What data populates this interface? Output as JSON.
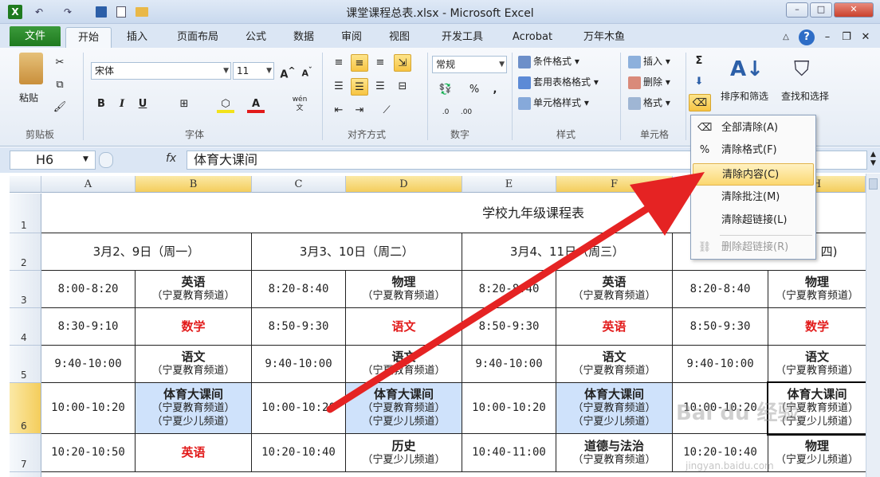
{
  "window": {
    "title": "课堂课程总表.xlsx - Microsoft Excel",
    "controls": [
      "–",
      "□",
      "✕"
    ]
  },
  "tabs": [
    {
      "label": "文件"
    },
    {
      "label": "开始"
    },
    {
      "label": "插入"
    },
    {
      "label": "页面布局"
    },
    {
      "label": "公式"
    },
    {
      "label": "数据"
    },
    {
      "label": "审阅"
    },
    {
      "label": "视图"
    },
    {
      "label": "开发工具"
    },
    {
      "label": "Acrobat"
    },
    {
      "label": "万年木鱼"
    }
  ],
  "ribbon": {
    "paste": "粘贴",
    "font_name": "宋体",
    "font_size": "11",
    "number_format": "常规",
    "conditional": "条件格式",
    "table_format": "套用表格格式",
    "cell_style": "单元格样式",
    "insert": "插入",
    "delete": "删除",
    "format": "格式",
    "sort_filter": "排序和筛选",
    "find_select": "查找和选择",
    "sigma": "Σ",
    "groups": [
      "剪贴板",
      "字体",
      "对齐方式",
      "数字",
      "样式",
      "单元格"
    ],
    "bold": "B",
    "italic": "I",
    "underline": "U",
    "percent": "%",
    "wen": "wén"
  },
  "formula_bar": {
    "name_box": "H6",
    "fx": "fx",
    "content": "体育大课间"
  },
  "columns": [
    "A",
    "B",
    "C",
    "D",
    "E",
    "F",
    "G",
    "H"
  ],
  "rows": [
    "1",
    "2",
    "3",
    "4",
    "5",
    "6",
    "7"
  ],
  "sheet": {
    "title": "学校九年级课程表",
    "day_headers": [
      "3月2、9日（周一）",
      "3月3、10日（周二）",
      "3月4、11日（周三）",
      "四)"
    ],
    "row3": [
      {
        "t": "8:00-8:20"
      },
      {
        "main": "英语",
        "sub": "（宁夏教育频道）"
      },
      {
        "t": "8:20-8:40"
      },
      {
        "main": "物理",
        "sub": "（宁夏教育频道）"
      },
      {
        "t": "8:20-8:40"
      },
      {
        "main": "英语",
        "sub": "（宁夏教育频道）"
      },
      {
        "t": "8:20-8:40"
      },
      {
        "main": "物理",
        "sub": "（宁夏教育频道）"
      }
    ],
    "row4": [
      {
        "t": "8:30-9:10"
      },
      {
        "main": "数学"
      },
      {
        "t": "8:50-9:30"
      },
      {
        "main": "语文"
      },
      {
        "t": "8:50-9:30"
      },
      {
        "main": "英语"
      },
      {
        "t": "8:50-9:30"
      },
      {
        "main": "数学"
      }
    ],
    "row5": [
      {
        "t": "9:40-10:00"
      },
      {
        "main": "语文",
        "sub": "（宁夏教育频道）"
      },
      {
        "t": "9:40-10:00"
      },
      {
        "main": "语文",
        "sub": "（宁夏教育频道）"
      },
      {
        "t": "9:40-10:00"
      },
      {
        "main": "语文",
        "sub": "（宁夏教育频道）"
      },
      {
        "t": "9:40-10:00"
      },
      {
        "main": "语文",
        "sub": "（宁夏教育频道）"
      }
    ],
    "row6": [
      {
        "t": "10:00-10:20"
      },
      {
        "main": "体育大课间",
        "sub": "（宁夏教育频道）",
        "sub2": "（宁夏少儿频道）"
      },
      {
        "t": "10:00-10:20"
      },
      {
        "main": "体育大课间",
        "sub": "（宁夏教育频道）",
        "sub2": "（宁夏少儿频道）"
      },
      {
        "t": "10:00-10:20"
      },
      {
        "main": "体育大课间",
        "sub": "（宁夏教育频道）",
        "sub2": "（宁夏少儿频道）"
      },
      {
        "t": "10:00-10:20"
      },
      {
        "main": "体育大课间",
        "sub": "（宁夏教育频道）",
        "sub2": "（宁夏少儿频道）"
      }
    ],
    "row7": [
      {
        "t": "10:20-10:50"
      },
      {
        "main": "英语"
      },
      {
        "t": "10:20-10:40"
      },
      {
        "main": "历史",
        "sub": "（宁夏少儿频道）"
      },
      {
        "t": "10:40-11:00"
      },
      {
        "main": "道德与法治",
        "sub": "（宁夏教育频道）"
      },
      {
        "t": "10:20-10:40"
      },
      {
        "main": "物理",
        "sub": "（宁夏少儿频道）"
      }
    ]
  },
  "clear_menu": {
    "items": [
      {
        "label": "全部清除(A)",
        "icon": "eraser-icon"
      },
      {
        "label": "清除格式(F)",
        "icon": "clear-format-icon"
      },
      {
        "label": "清除内容(C)",
        "icon": "clear-contents-icon"
      },
      {
        "label": "清除批注(M)",
        "icon": "clear-comments-icon"
      },
      {
        "label": "清除超链接(L)",
        "icon": "clear-hyperlinks-icon"
      },
      {
        "label": "删除超链接(R)",
        "icon": "remove-hyperlinks-icon"
      }
    ]
  },
  "watermark": {
    "brand": "Bai du 经验",
    "url": "jingyan.baidu.com"
  },
  "colors": {
    "selected_fill": "#cfe2fb",
    "accent_red": "#e21a1a",
    "arrow": "#e52323"
  }
}
